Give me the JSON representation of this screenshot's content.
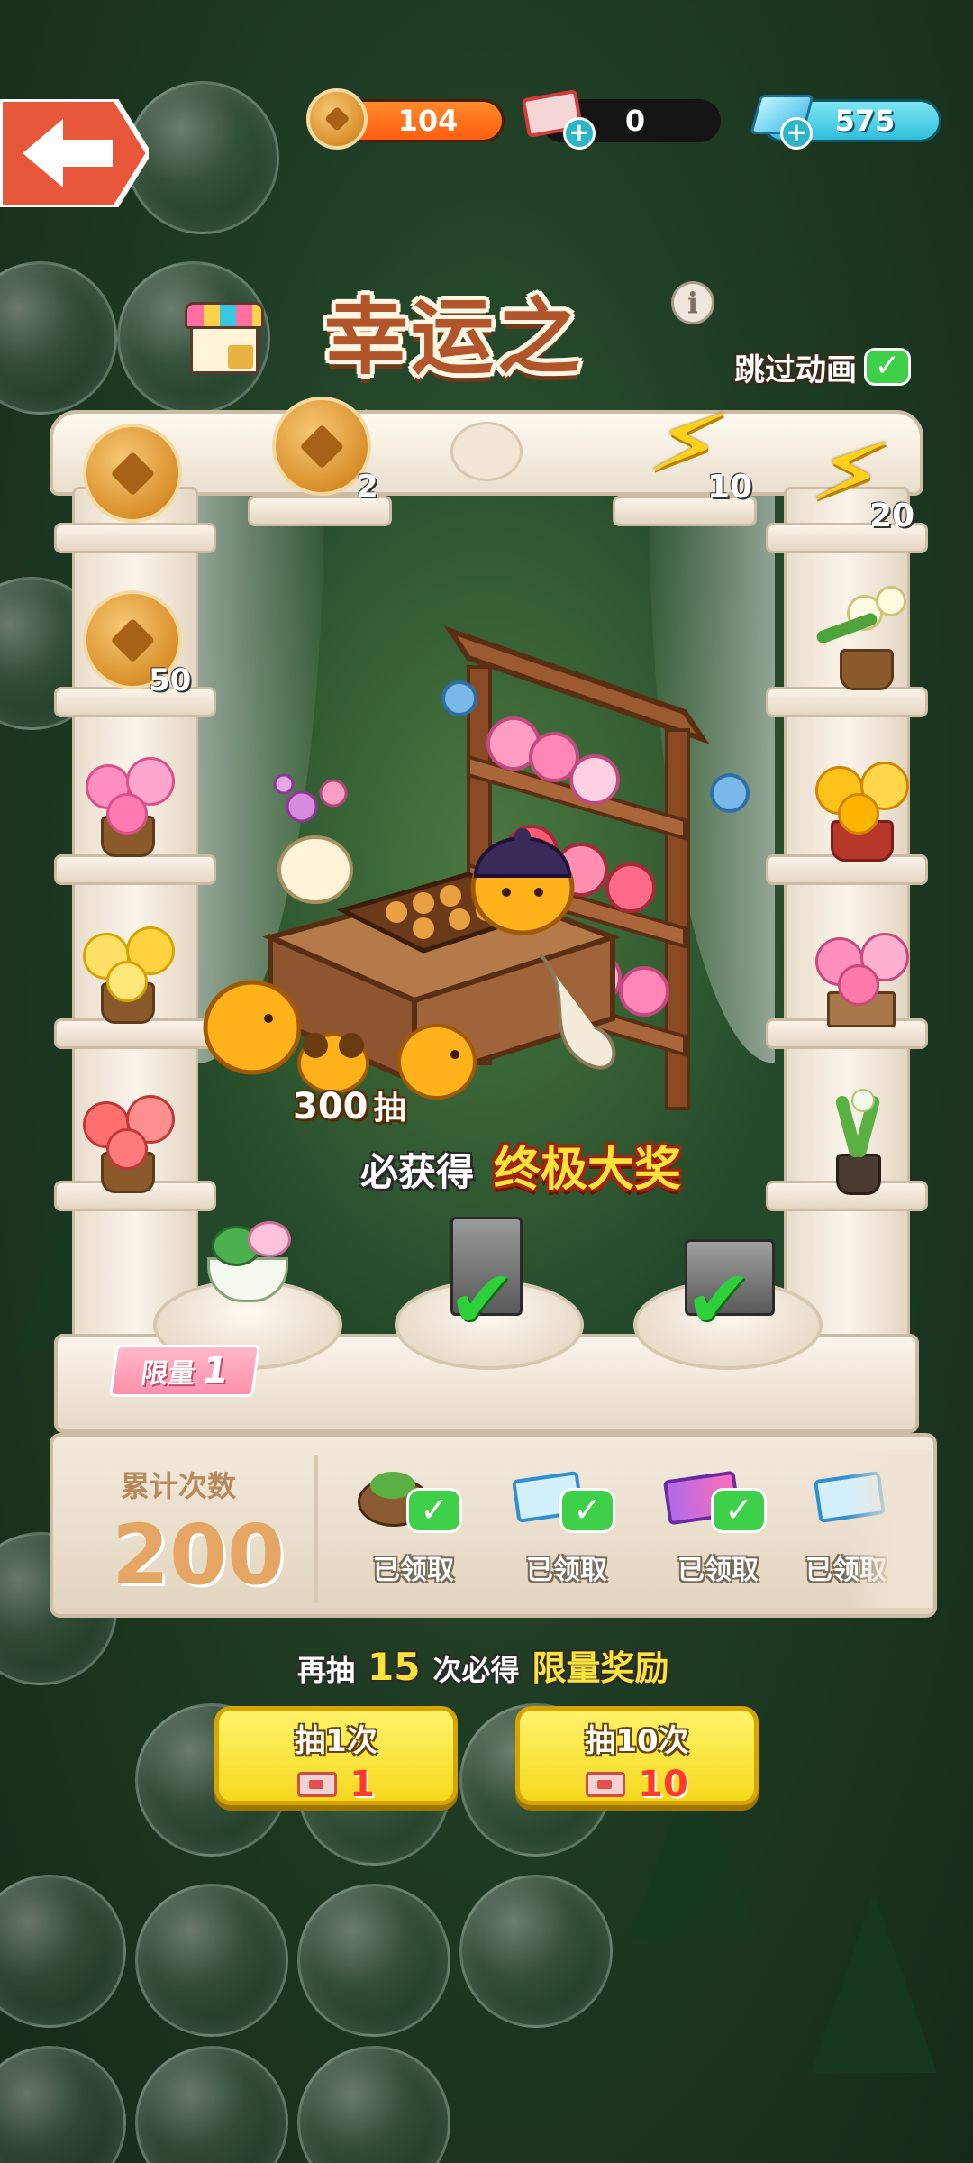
{
  "top_bar": {
    "coins": "104",
    "tickets": "0",
    "diamonds": "575"
  },
  "title": {
    "text": "幸运之窗",
    "skip_animation": "跳过动画"
  },
  "prizes": {
    "top_coin_count": "2",
    "bolt_small_count": "10",
    "bolt_large_count": "20",
    "left_coin_count": "50"
  },
  "promo": {
    "draws": "300",
    "draws_suffix": "抽",
    "guarantee": "必获得",
    "grand_prize": "终极大奖"
  },
  "limited": {
    "label": "限量",
    "count": "1"
  },
  "progress": {
    "label": "累计次数",
    "value": "200",
    "rewards": [
      {
        "status": "已领取"
      },
      {
        "status": "已领取"
      },
      {
        "status": "已领取"
      },
      {
        "status": "已领取"
      }
    ]
  },
  "hint": {
    "prefix": "再抽",
    "count": "15",
    "middle": "次必得",
    "reward": "限量奖励"
  },
  "buttons": {
    "draw_one": {
      "label": "抽1次",
      "cost": "1"
    },
    "draw_ten": {
      "label": "抽10次",
      "cost": "10"
    }
  },
  "colors": {
    "coin_bar": "#ff6a1a",
    "diamond_bar": "#3ccde6",
    "highlight_text": "#ffe23a",
    "button": "#f6d91e"
  }
}
